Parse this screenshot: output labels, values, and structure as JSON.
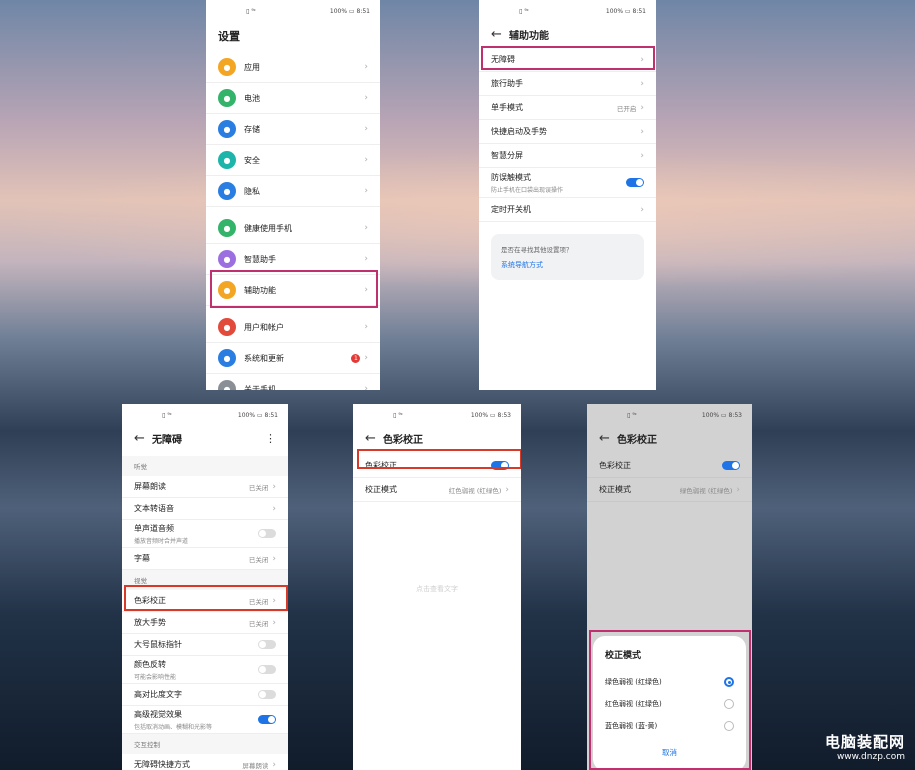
{
  "settings": {
    "status_left": "▯ ⁹ᶜ",
    "status_right": "100% ▭ 8:51",
    "title": "设置",
    "items": [
      {
        "label": "应用",
        "color": "#f3a623",
        "icon": "apps-icon"
      },
      {
        "label": "电池",
        "color": "#34b36a",
        "icon": "battery-icon"
      },
      {
        "label": "存储",
        "color": "#2a7de1",
        "icon": "storage-icon"
      },
      {
        "label": "安全",
        "color": "#1db5a9",
        "icon": "shield-icon"
      },
      {
        "label": "隐私",
        "color": "#2a7de1",
        "icon": "privacy-icon"
      },
      {
        "label": "健康使用手机",
        "color": "#34b36a",
        "icon": "hourglass-icon"
      },
      {
        "label": "智慧助手",
        "color": "#9c6fe0",
        "icon": "assistant-icon"
      },
      {
        "label": "辅助功能",
        "color": "#f3a623",
        "icon": "hand-icon"
      },
      {
        "label": "用户和帐户",
        "color": "#e24a3b",
        "icon": "user-icon"
      },
      {
        "label": "系统和更新",
        "color": "#2a7de1",
        "icon": "system-icon",
        "badge": "1"
      },
      {
        "label": "关于手机",
        "color": "#8a8f96",
        "icon": "phone-icon"
      }
    ]
  },
  "accessibility": {
    "status_right": "100% ▭ 8:51",
    "title": "辅助功能",
    "items": [
      {
        "label": "无障碍"
      },
      {
        "label": "旅行助手"
      },
      {
        "label": "单手模式",
        "value": "已开启"
      },
      {
        "label": "快捷启动及手势"
      },
      {
        "label": "智慧分屏"
      },
      {
        "label": "防误触模式",
        "sub": "防止手机在口袋出现误操作",
        "toggle": true
      },
      {
        "label": "定时开关机"
      }
    ],
    "card_question": "是否在寻找其他设置项？",
    "card_link": "系统导航方式"
  },
  "barrier_free": {
    "status_right": "100% ▭ 8:51",
    "title": "无障碍",
    "section_hearing": "听觉",
    "hearing_items": [
      {
        "label": "屏幕朗读",
        "value": "已关闭"
      },
      {
        "label": "文本转语音"
      },
      {
        "label": "单声道音频",
        "sub": "播放音频时合并声道",
        "toggle": false
      },
      {
        "label": "字幕",
        "value": "已关闭"
      }
    ],
    "section_vision": "视觉",
    "vision_items": [
      {
        "label": "色彩校正",
        "value": "已关闭"
      },
      {
        "label": "放大手势",
        "value": "已关闭"
      },
      {
        "label": "大号鼠标指针",
        "toggle": false
      },
      {
        "label": "颜色反转",
        "sub": "可能会影响性能",
        "toggle": false
      },
      {
        "label": "高对比度文字",
        "toggle": false
      },
      {
        "label": "高级视觉效果",
        "sub": "包括取消动画、模糊和光影等",
        "toggle": true
      }
    ],
    "section_interaction": "交互控制",
    "interaction_items": [
      {
        "label": "无障碍快捷方式",
        "value": "屏幕朗读"
      }
    ]
  },
  "color_correction": {
    "status_right": "100% ▭ 8:53",
    "title": "色彩校正",
    "toggle_label": "色彩校正",
    "mode_label": "校正模式",
    "mode_value": "红色弱视 (红绿色)",
    "hint": "点击查看文字"
  },
  "color_correction_dialog": {
    "status_right": "100% ▭ 8:53",
    "title": "色彩校正",
    "toggle_label": "色彩校正",
    "mode_label": "校正模式",
    "mode_value": "绿色弱视 (红绿色)",
    "sheet_title": "校正模式",
    "options": [
      {
        "label": "绿色弱视 (红绿色)",
        "selected": true
      },
      {
        "label": "红色弱视 (红绿色)",
        "selected": false
      },
      {
        "label": "蓝色弱视 (蓝-黄)",
        "selected": false
      }
    ],
    "cancel": "取消"
  },
  "watermark": {
    "line1": "电脑装配网",
    "line2": "www.dnzp.com"
  },
  "colors": {
    "accent": "#1e74e6",
    "highlight_pink": "#c0306e",
    "highlight_red": "#d83a2a"
  }
}
